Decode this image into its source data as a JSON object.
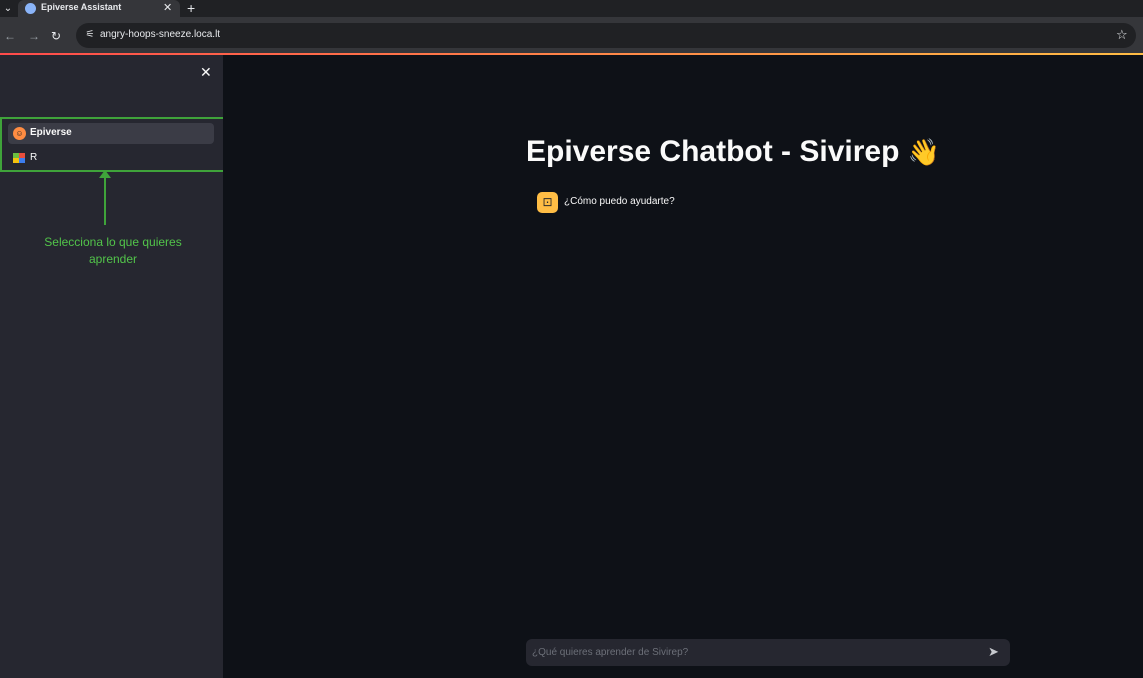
{
  "browser": {
    "tab_title": "Epiverse Assistant",
    "tab_close": "✕",
    "new_tab": "+",
    "back": "←",
    "forward": "→",
    "reload": "↻",
    "url": "angry-hoops-sneeze.loca.lt",
    "star": "☆",
    "icons": {
      "tab_favicon": "robot-icon",
      "site_info": "tune-icon",
      "bookmark": "star-icon"
    }
  },
  "sidebar": {
    "close": "✕",
    "items": [
      {
        "label": "Epiverse",
        "icon": "epiverse-emoji-icon",
        "active": true
      },
      {
        "label": "R",
        "icon": "colored-squares-icon",
        "active": false
      }
    ],
    "annotation": "Selecciona lo que quieres aprender",
    "annotation_color": "#3fa33a"
  },
  "main": {
    "title": "Epiverse Chatbot - Sivirep",
    "title_emoji": "👋",
    "messages": [
      {
        "role": "assistant",
        "text": "¿Cómo puedo ayudarte?",
        "avatar_icon": "bot-icon"
      }
    ],
    "chat_input": {
      "placeholder": "¿Qué quieres aprender de Sivirep?",
      "value": ""
    },
    "send_icon": "send-icon"
  },
  "colors": {
    "background": "#0e1117",
    "sidebar": "#262730",
    "accent_orange": "#ffbd45",
    "progress_red": "#ff4b4b"
  }
}
